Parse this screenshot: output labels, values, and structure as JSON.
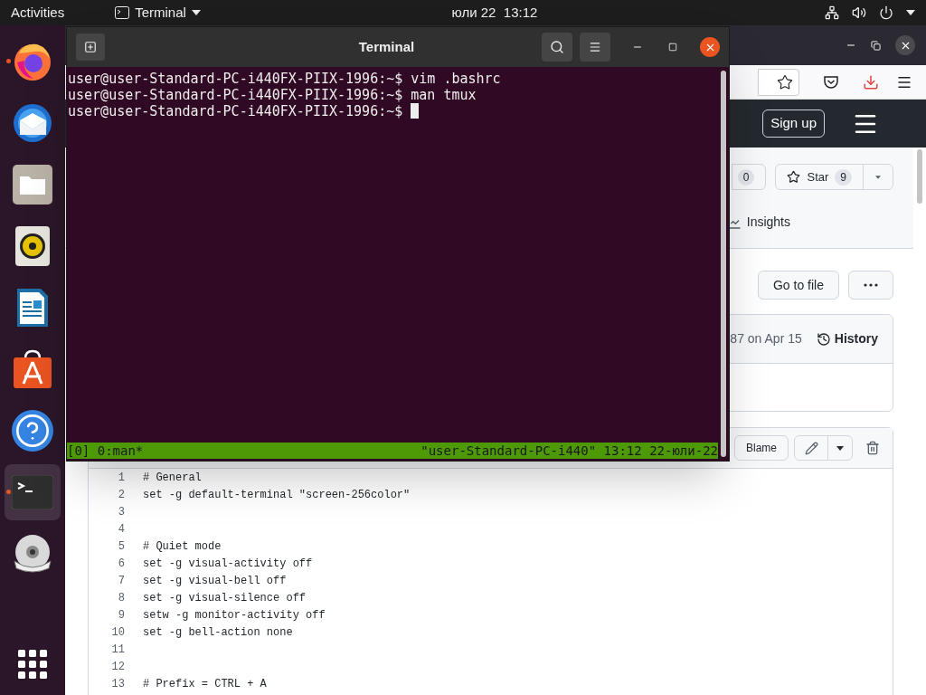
{
  "top_bar": {
    "activities": "Activities",
    "app_menu": "Terminal",
    "clock": "юли 22  13:12"
  },
  "dock": {
    "items": [
      {
        "kind": "browser",
        "running": true,
        "selected": false
      },
      {
        "kind": "mail",
        "running": false,
        "selected": false
      },
      {
        "kind": "files",
        "running": false,
        "selected": false
      },
      {
        "kind": "music",
        "running": false,
        "selected": false
      },
      {
        "kind": "writer",
        "running": false,
        "selected": false
      },
      {
        "kind": "store",
        "running": false,
        "selected": false
      },
      {
        "kind": "help",
        "running": false,
        "selected": false
      },
      {
        "kind": "terminal",
        "running": true,
        "selected": true
      },
      {
        "kind": "disc",
        "running": false,
        "selected": false
      }
    ]
  },
  "browser": {
    "sign_up": "Sign up",
    "watch_count": "0",
    "star_label": "Star",
    "star_count": "9",
    "tab": "Insights",
    "go_to_file": "Go to file",
    "commit": "87 on Apr 15",
    "history": "History",
    "blame": "Blame",
    "code_lines": [
      {
        "number": "1",
        "code": "# General"
      },
      {
        "number": "2",
        "code": "set -g default-terminal \"screen-256color\""
      },
      {
        "number": "3"
      },
      {
        "number": "4"
      },
      {
        "number": "5",
        "code": "# Quiet mode"
      },
      {
        "number": "6",
        "code": "set -g visual-activity off"
      },
      {
        "number": "7",
        "code": "set -g visual-bell off"
      },
      {
        "number": "8",
        "code": "set -g visual-silence off"
      },
      {
        "number": "9",
        "code": "setw -g monitor-activity off"
      },
      {
        "number": "10",
        "code": "set -g bell-action none"
      },
      {
        "number": "11"
      },
      {
        "number": "12"
      },
      {
        "number": "13",
        "code": "# Prefix = CTRL + A"
      }
    ]
  },
  "terminal": {
    "title": "Terminal",
    "lines": [
      "user@user-Standard-PC-i440FX-PIIX-1996:~$ vim .bashrc",
      "user@user-Standard-PC-i440FX-PIIX-1996:~$ man tmux",
      "user@user-Standard-PC-i440FX-PIIX-1996:~$ "
    ],
    "status_left": "[0] 0:man*",
    "status_right": "\"user-Standard-PC-i440\" 13:12 22-юли-22"
  }
}
